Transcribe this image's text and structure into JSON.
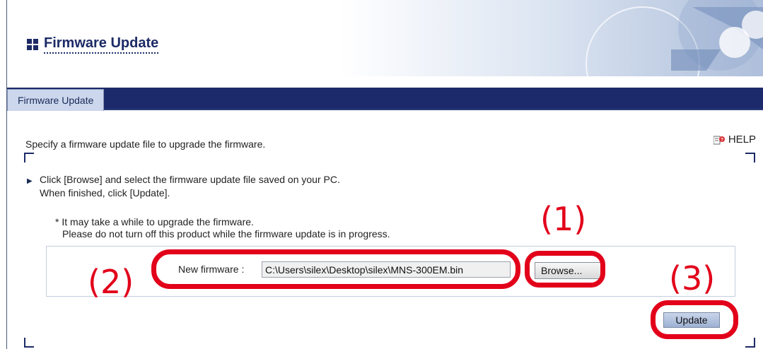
{
  "header": {
    "title": "Firmware Update"
  },
  "tabs": [
    {
      "label": "Firmware Update",
      "active": true
    }
  ],
  "content": {
    "intro": "Specify a firmware update file to upgrade the firmware.",
    "help_label": "HELP",
    "instructions": {
      "line1": "Click [Browse] and select the firmware update file saved on your PC.",
      "line2": "When finished, click [Update]."
    },
    "note": {
      "line1": "* It may take a while to upgrade the firmware.",
      "line2": "Please do not turn off this product while the firmware update is in progress."
    },
    "new_firmware": {
      "label": "New firmware :",
      "value": "C:\\Users\\silex\\Desktop\\silex\\MNS-300EM.bin",
      "browse_label": "Browse..."
    },
    "update_label": "Update"
  },
  "callouts": {
    "c1": "(1)",
    "c2": "(2)",
    "c3": "(3)"
  },
  "colors": {
    "brand_navy": "#1c2a6b",
    "callout_red": "#e2001a",
    "tab_bg": "#ccd7ee"
  },
  "icons": {
    "title": "grid-icon",
    "help": "help-book-icon",
    "instruction": "triangle-right-icon"
  }
}
